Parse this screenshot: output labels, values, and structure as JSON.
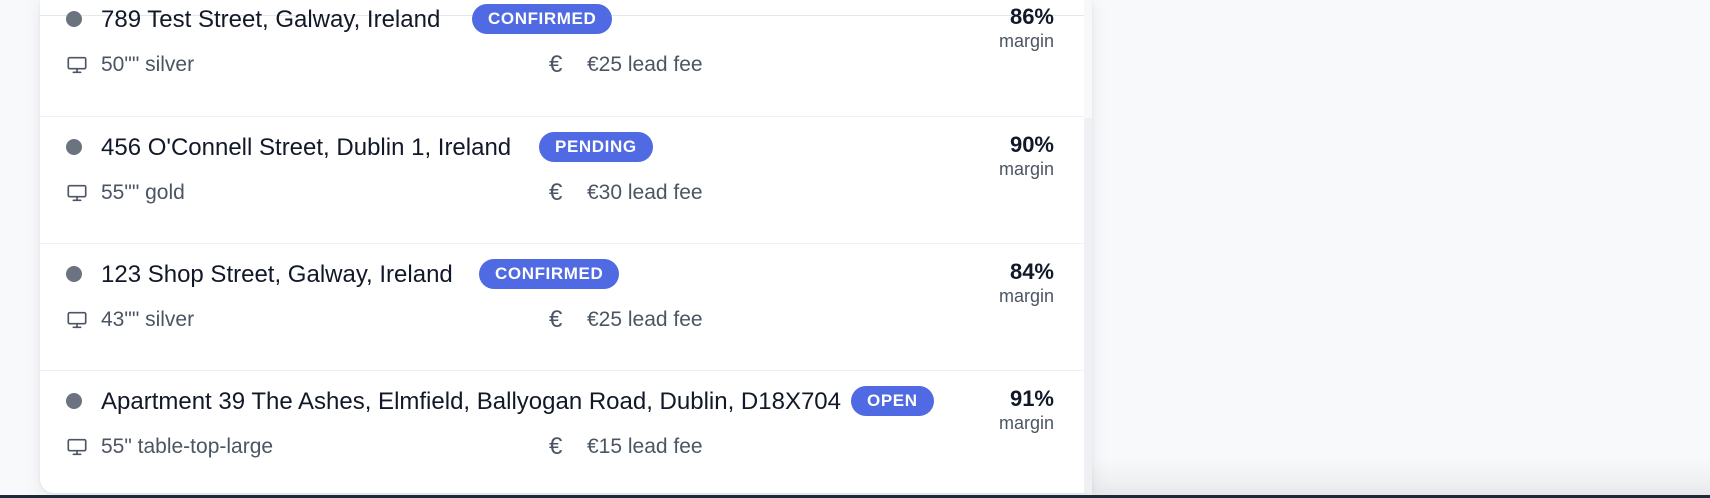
{
  "listings": [
    {
      "address": "789 Test Street, Galway, Ireland",
      "status": "CONFIRMED",
      "screen": "50\"\" silver",
      "fee": "€25 lead fee",
      "margin_pct": "86%",
      "margin_label": "margin"
    },
    {
      "address": "456 O'Connell Street, Dublin 1, Ireland",
      "status": "PENDING",
      "screen": "55\"\" gold",
      "fee": "€30 lead fee",
      "margin_pct": "90%",
      "margin_label": "margin"
    },
    {
      "address": "123 Shop Street, Galway, Ireland",
      "status": "CONFIRMED",
      "screen": "43\"\" silver",
      "fee": "€25 lead fee",
      "margin_pct": "84%",
      "margin_label": "margin"
    },
    {
      "address": "Apartment 39 The Ashes, Elmfield, Ballyogan Road, Dublin, D18X704",
      "status": "OPEN",
      "screen": "55\" table-top-large",
      "fee": "€15 lead fee",
      "margin_pct": "91%",
      "margin_label": "margin"
    }
  ],
  "icons": {
    "status": "status-dot-icon",
    "screen": "monitor-icon",
    "fee": "euro-icon"
  },
  "colors": {
    "badge": "#4f6ae2",
    "dot": "#6b7280",
    "text": "#111827",
    "muted": "#4b5563"
  }
}
